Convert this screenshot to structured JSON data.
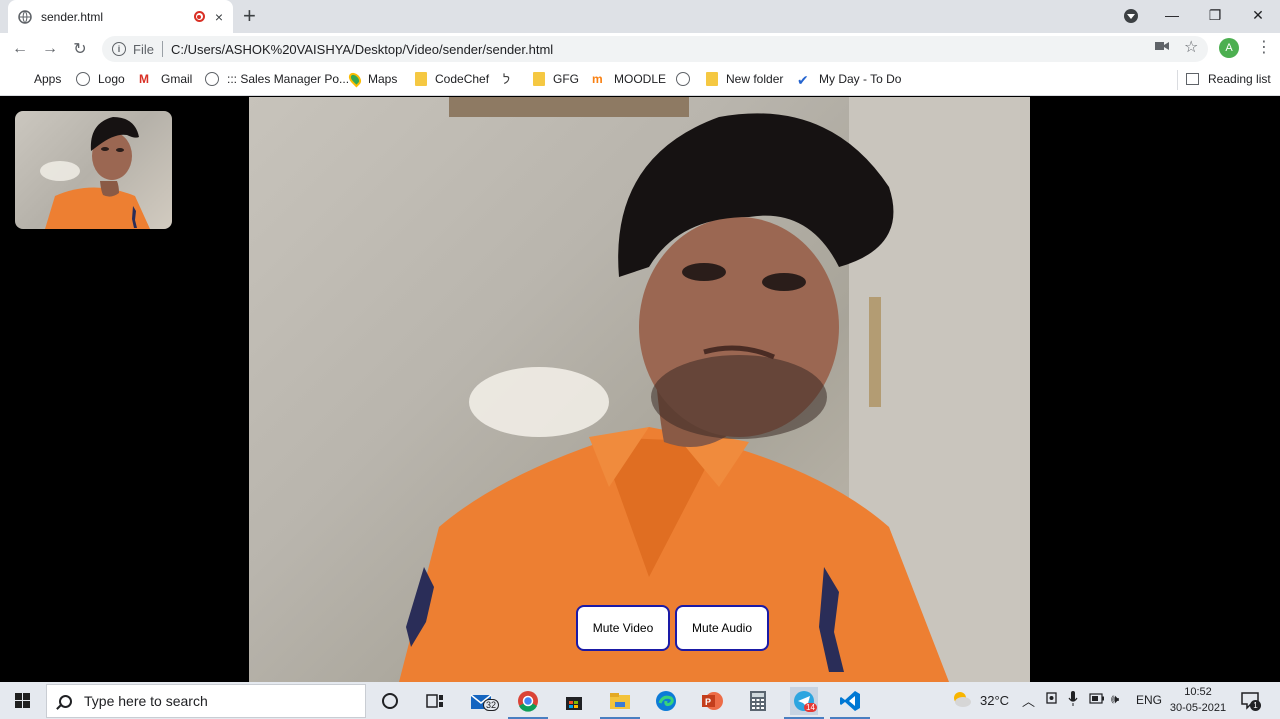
{
  "tab": {
    "title": "sender.html",
    "close": "×",
    "new_tab": "+"
  },
  "window_controls": {
    "minimize": "—",
    "maximize": "❐",
    "close": "✕"
  },
  "toolbar": {
    "back": "←",
    "forward": "→",
    "reload": "↻",
    "scheme": "File",
    "url": "C:/Users/ASHOK%20VAISHYA/Desktop/Video/sender/sender.html",
    "profile_initial": "A"
  },
  "bookmarks": [
    {
      "label": "Apps",
      "icon": "apps-icon"
    },
    {
      "label": "Logo",
      "icon": "globe-icon"
    },
    {
      "label": "Gmail",
      "icon": "gmail-icon"
    },
    {
      "label": "::: Sales Manager Po...",
      "icon": "globe-icon"
    },
    {
      "label": "Maps",
      "icon": "maps-icon"
    },
    {
      "label": "CodeChef",
      "icon": "folder-icon"
    },
    {
      "label": "",
      "icon": "leetcode-icon"
    },
    {
      "label": "GFG",
      "icon": "folder-icon"
    },
    {
      "label": "MOODLE",
      "icon": "moodle-icon"
    },
    {
      "label": "",
      "icon": "globe-icon"
    },
    {
      "label": "New folder",
      "icon": "folder-icon"
    },
    {
      "label": "My Day - To Do",
      "icon": "todo-icon"
    }
  ],
  "reading_list": "Reading list",
  "video": {
    "mute_video": "Mute Video",
    "mute_audio": "Mute Audio"
  },
  "taskbar": {
    "search_placeholder": "Type here to search",
    "mail_badge": "32",
    "telegram_badge": "14",
    "temperature": "32°C",
    "language": "ENG",
    "time": "10:52",
    "date": "30-05-2021",
    "notification_count": "1"
  },
  "colors": {
    "accent_blue": "#1a1aa6",
    "chrome_tab_bg": "#dee1e6",
    "taskbar_bg": "#e5e9ef"
  }
}
